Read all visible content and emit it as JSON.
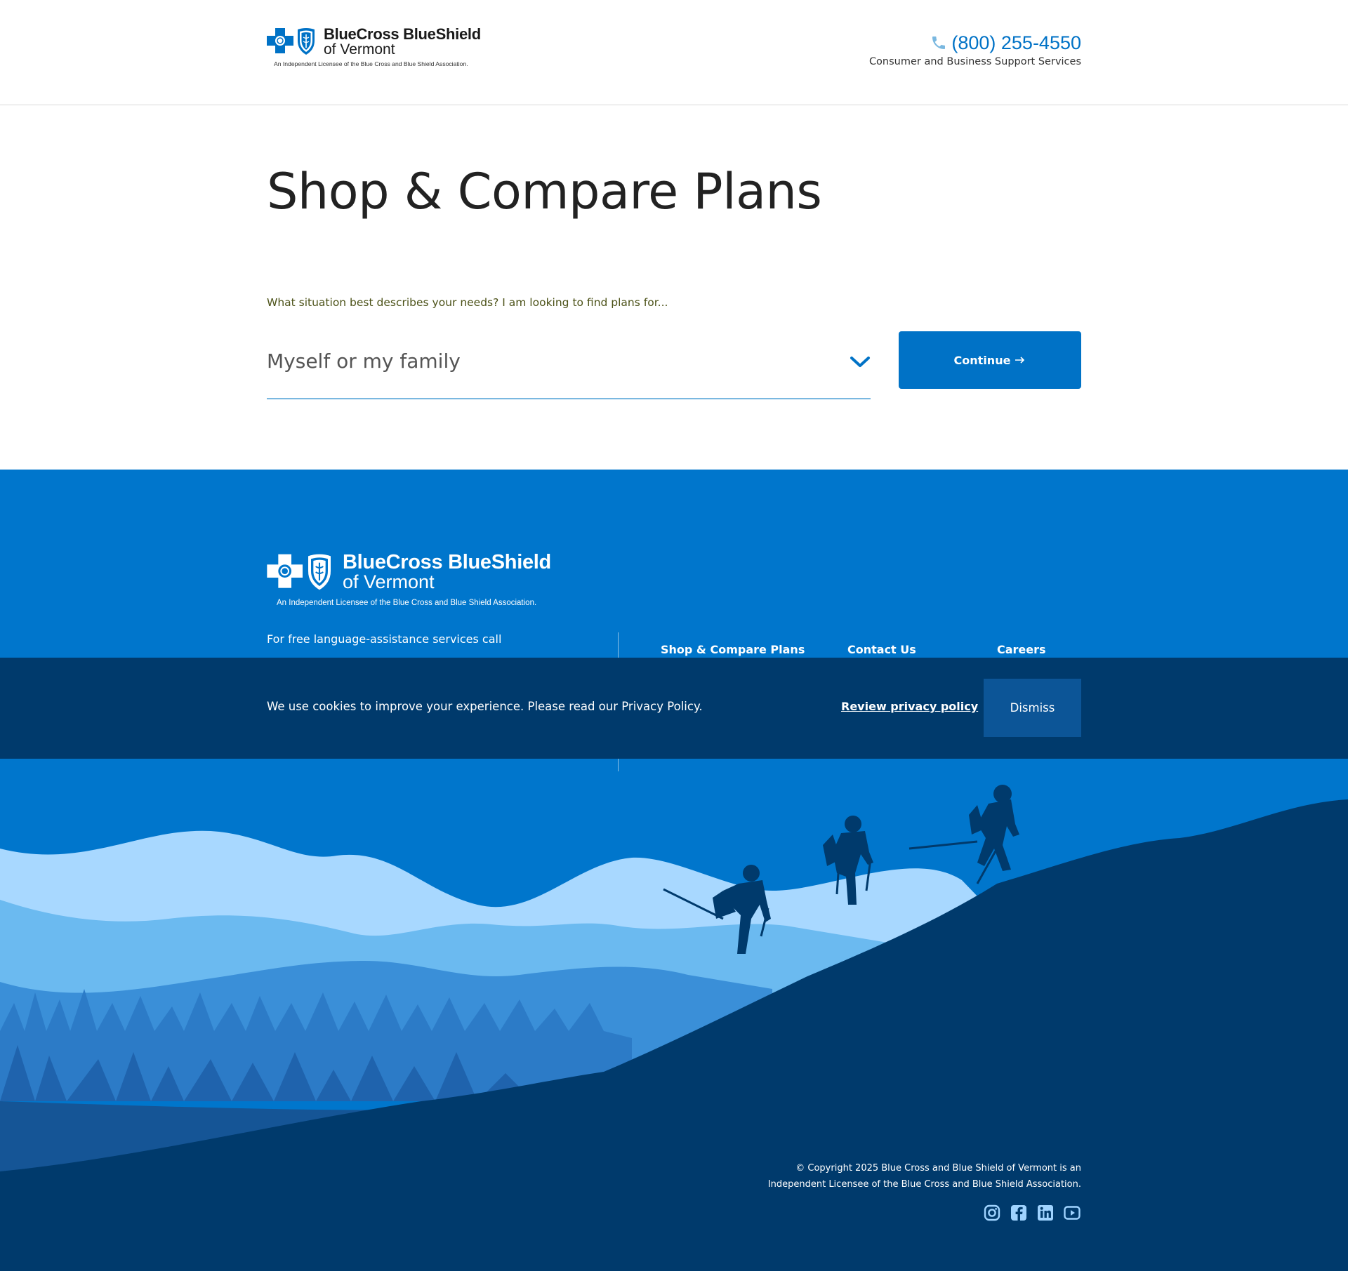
{
  "header": {
    "logo": {
      "brand": "BlueCross BlueShield",
      "sub": "of Vermont",
      "tagline": "An Independent Licensee of the Blue Cross and Blue Shield Association."
    },
    "phone": {
      "number": "(800) 255-4550",
      "subtitle": "Consumer and Business Support Services"
    }
  },
  "main": {
    "title": "Shop & Compare Plans",
    "question": "What situation best describes your needs? I am looking to find plans for...",
    "select_value": "Myself or my family",
    "continue_label": "Continue"
  },
  "footer": {
    "logo": {
      "brand": "BlueCross BlueShield",
      "sub": "of Vermont",
      "tagline": "An Independent Licensee of the Blue Cross and Blue Shield Association."
    },
    "language_text": "For free language-assistance services call",
    "links": [
      "Shop & Compare Plans",
      "Contact Us",
      "Careers"
    ],
    "copyright_line1": "© Copyright 2025 Blue Cross and Blue Shield of Vermont is an",
    "copyright_line2": "Independent Licensee of the Blue Cross and Blue Shield Association.",
    "social": [
      "instagram-icon",
      "facebook-icon",
      "linkedin-icon",
      "youtube-icon"
    ]
  },
  "cookie": {
    "text": "We use cookies to improve your experience. Please read our Privacy Policy.",
    "review_label": "Review privacy policy",
    "dismiss_label": "Dismiss"
  },
  "colors": {
    "brand_blue": "#0072c6",
    "footer_blue": "#0076cc",
    "cookie_navy": "#003a6c",
    "dismiss_blue": "#0c5597",
    "mountain_dark": "#003a6c"
  }
}
